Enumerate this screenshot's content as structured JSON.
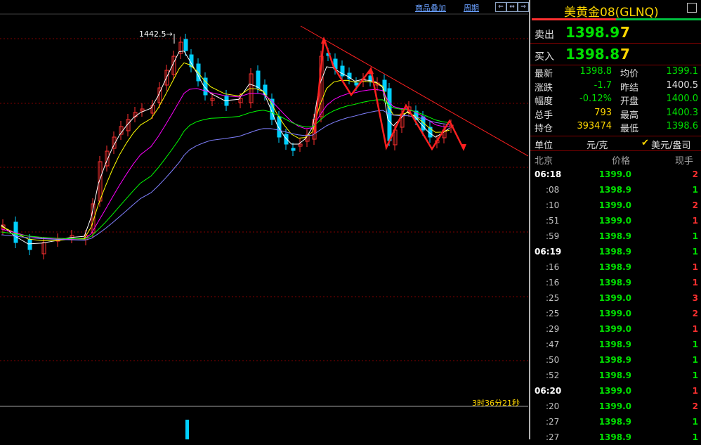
{
  "toolbar": {
    "overlay": "商品叠加",
    "period": "周期",
    "nav_left": "⇐",
    "nav_both": "⇔",
    "nav_right": "⇒"
  },
  "chart": {
    "high_label": "1442.5",
    "countdown": "3时36分21秒"
  },
  "panel": {
    "title": "美黄金08(GLNQ)",
    "sell": {
      "label": "卖出",
      "price": "1398.9",
      "qty": "7"
    },
    "buy": {
      "label": "买入",
      "price": "1398.8",
      "qty": "7"
    },
    "stats": [
      {
        "l1": "最新",
        "v1": "1398.8",
        "c1": "#00e000",
        "l2": "均价",
        "v2": "1399.1",
        "c2": "#00e000"
      },
      {
        "l1": "涨跌",
        "v1": "-1.7",
        "c1": "#00e000",
        "l2": "昨结",
        "v2": "1400.5",
        "c2": "#e0e0e0"
      },
      {
        "l1": "幅度",
        "v1": "-0.12%",
        "c1": "#00e000",
        "l2": "开盘",
        "v2": "1400.0",
        "c2": "#00e000"
      },
      {
        "l1": "总手",
        "v1": "793",
        "c1": "#ffd700",
        "l2": "最高",
        "v2": "1400.3",
        "c2": "#00e000"
      },
      {
        "l1": "持仓",
        "v1": "393474",
        "c1": "#ffd700",
        "l2": "最低",
        "v2": "1398.6",
        "c2": "#00e000"
      }
    ],
    "unit": {
      "label": "单位",
      "value": "元/克",
      "check": "✔",
      "alt": "美元/盎司"
    },
    "trades_header": {
      "time": "北京",
      "price": "价格",
      "qty": "现手"
    },
    "trades": [
      {
        "time": "06:18",
        "price": "1399.0",
        "qty": "2",
        "bold": true,
        "pc": "#00e000",
        "qc": "#ff3030"
      },
      {
        "time": ":08",
        "price": "1398.9",
        "qty": "1",
        "bold": false,
        "pc": "#00e000",
        "qc": "#00e000"
      },
      {
        "time": ":10",
        "price": "1399.0",
        "qty": "2",
        "bold": false,
        "pc": "#00e000",
        "qc": "#ff3030"
      },
      {
        "time": ":51",
        "price": "1399.0",
        "qty": "1",
        "bold": false,
        "pc": "#00e000",
        "qc": "#ff3030"
      },
      {
        "time": ":59",
        "price": "1398.9",
        "qty": "1",
        "bold": false,
        "pc": "#00e000",
        "qc": "#00e000"
      },
      {
        "time": "06:19",
        "price": "1398.9",
        "qty": "1",
        "bold": true,
        "pc": "#00e000",
        "qc": "#00e000"
      },
      {
        "time": ":16",
        "price": "1398.9",
        "qty": "1",
        "bold": false,
        "pc": "#00e000",
        "qc": "#ff3030"
      },
      {
        "time": ":16",
        "price": "1398.9",
        "qty": "1",
        "bold": false,
        "pc": "#00e000",
        "qc": "#ff3030"
      },
      {
        "time": ":25",
        "price": "1399.0",
        "qty": "3",
        "bold": false,
        "pc": "#00e000",
        "qc": "#ff3030"
      },
      {
        "time": ":25",
        "price": "1399.0",
        "qty": "2",
        "bold": false,
        "pc": "#00e000",
        "qc": "#ff3030"
      },
      {
        "time": ":29",
        "price": "1399.0",
        "qty": "1",
        "bold": false,
        "pc": "#00e000",
        "qc": "#ff3030"
      },
      {
        "time": ":47",
        "price": "1398.9",
        "qty": "1",
        "bold": false,
        "pc": "#00e000",
        "qc": "#00e000"
      },
      {
        "time": ":50",
        "price": "1398.9",
        "qty": "1",
        "bold": false,
        "pc": "#00e000",
        "qc": "#00e000"
      },
      {
        "time": ":52",
        "price": "1398.9",
        "qty": "1",
        "bold": false,
        "pc": "#00e000",
        "qc": "#00e000"
      },
      {
        "time": "06:20",
        "price": "1399.0",
        "qty": "1",
        "bold": true,
        "pc": "#00e000",
        "qc": "#ff3030"
      },
      {
        "time": ":20",
        "price": "1399.0",
        "qty": "2",
        "bold": false,
        "pc": "#00e000",
        "qc": "#ff3030"
      },
      {
        "time": ":27",
        "price": "1398.9",
        "qty": "1",
        "bold": false,
        "pc": "#00e000",
        "qc": "#00e000"
      },
      {
        "time": ":27",
        "price": "1398.9",
        "qty": "1",
        "bold": false,
        "pc": "#00e000",
        "qc": "#00e000"
      }
    ]
  },
  "colors": {
    "up": "#ff3030",
    "down": "#00d0ff",
    "ma5": "#ffffff",
    "ma10": "#ffff00",
    "ma20": "#ff00ff",
    "ma40": "#00ff00",
    "ma60": "#8080ff",
    "trend": "#ff2020",
    "grid": "#800000"
  }
}
